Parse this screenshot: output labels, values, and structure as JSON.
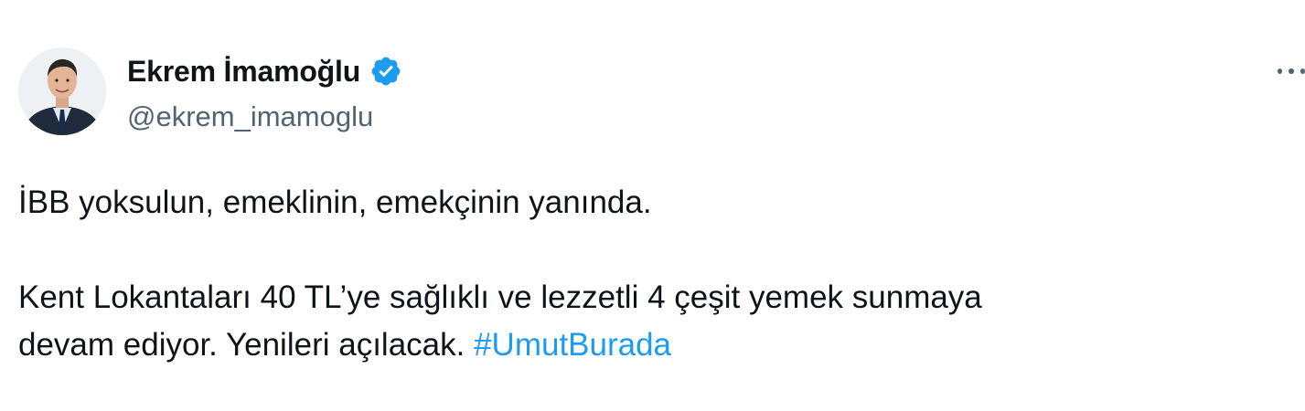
{
  "author": {
    "display_name": "Ekrem İmamoğlu",
    "handle": "@ekrem_imamoglu",
    "verified": true
  },
  "icons": {
    "verified": "verified-badge-icon",
    "more": "more-options-icon",
    "avatar": "profile-avatar"
  },
  "colors": {
    "text": "#0f1419",
    "secondary": "#536471",
    "link": "#1d9bf0"
  },
  "tweet": {
    "paragraph1": "İBB yoksulun, emeklinin, emekçinin yanında.",
    "paragraph2_line1": "Kent Lokantaları 40 TL’ye sağlıklı ve lezzetli 4 çeşit yemek sunmaya",
    "paragraph2_line2_text": "devam ediyor. Yenileri açılacak.",
    "hashtag": "#UmutBurada"
  }
}
